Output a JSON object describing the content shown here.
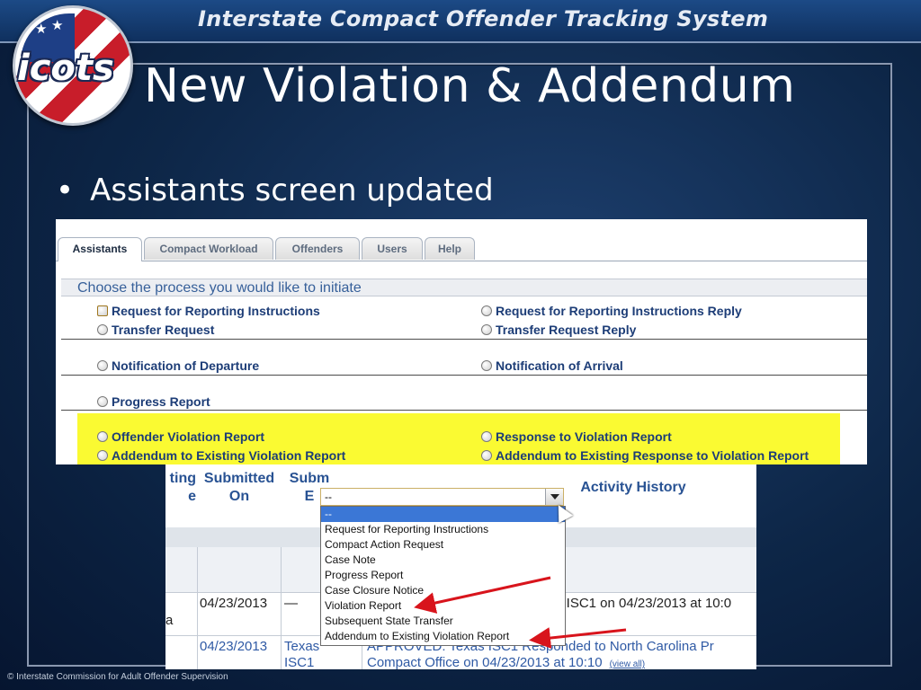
{
  "banner": {
    "title": "Interstate Compact Offender Tracking System"
  },
  "logo": {
    "text": "icots"
  },
  "slide": {
    "title": "New Violation & Addendum",
    "bullet": "Assistants screen updated"
  },
  "colors": {
    "highlight": "#fafa32",
    "link_blue": "#2f5aa5",
    "arrow_red": "#d8141c",
    "dropdown_selected": "#3b77d6"
  },
  "assistants_screen": {
    "tabs": [
      "Assistants",
      "Compact Workload",
      "Offenders",
      "Users",
      "Help"
    ],
    "active_tab": "Assistants",
    "prompt": "Choose the process you would like to initiate",
    "options": {
      "left": [
        "Request for Reporting Instructions",
        "Transfer Request",
        "Notification of Departure",
        "Progress Report",
        "Offender Violation Report",
        "Addendum to Existing Violation Report"
      ],
      "right": [
        "Request for Reporting Instructions Reply",
        "Transfer Request Reply",
        "Notification of Arrival",
        "Response to Violation Report",
        "Addendum to Existing Response to Violation Report"
      ]
    }
  },
  "workload_screen": {
    "select": {
      "value": "--",
      "options": [
        "--",
        "Request for Reporting Instructions",
        "Compact Action Request",
        "Case Note",
        "Progress Report",
        "Case Closure Notice",
        "Violation Report",
        "Subsequent State Transfer",
        "Addendum to Existing Violation Report"
      ]
    },
    "columns": [
      "ting",
      "e",
      "Submitted",
      "On",
      "Subm",
      "E",
      "Activity History"
    ],
    "rows": [
      {
        "submitting_partial": "a",
        "submitted_on": "04/23/2013",
        "submitted_by": "—",
        "activity": "s ISC1 on 04/23/2013 at 10:0"
      },
      {
        "submitting_partial": "",
        "submitted_on": "04/23/2013",
        "submitted_by": "Texas",
        "submitted_by_2": "ISC1",
        "activity": "APPROVED: Texas ISC1 Responded to North Carolina Pr",
        "activity_2": "Compact Office on 04/23/2013 at 10:10",
        "view_all": "(view all)"
      }
    ]
  },
  "footer": {
    "text": "© Interstate Commission for Adult Offender Supervision"
  }
}
